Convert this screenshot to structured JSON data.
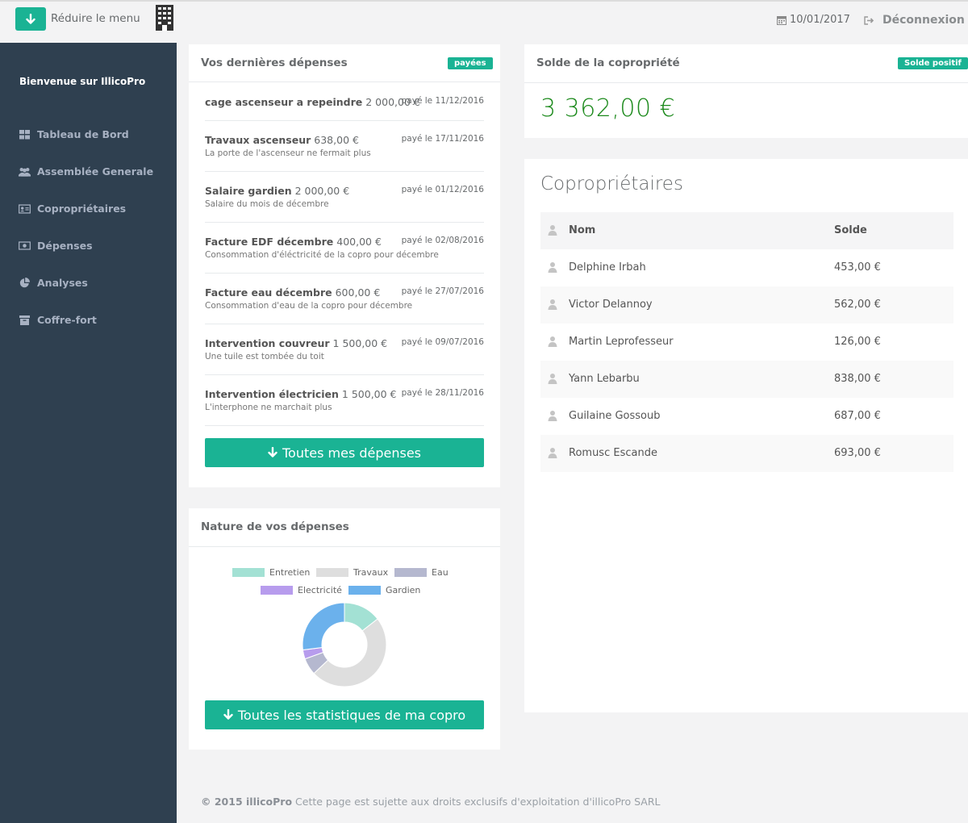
{
  "topbar": {
    "menu_label": "Réduire le menu",
    "date": "10/01/2017",
    "logout_label": "Déconnexion"
  },
  "sidebar": {
    "welcome": "Bienvenue sur IllicoPro",
    "items": [
      {
        "label": "Tableau de Bord",
        "icon": "dashboard-icon"
      },
      {
        "label": "Assemblée Generale",
        "icon": "users-icon"
      },
      {
        "label": "Copropriétaires",
        "icon": "id-card-icon"
      },
      {
        "label": "Dépenses",
        "icon": "money-icon"
      },
      {
        "label": "Analyses",
        "icon": "pie-chart-icon"
      },
      {
        "label": "Coffre-fort",
        "icon": "archive-icon"
      }
    ]
  },
  "expenses": {
    "title": "Vos dernières dépenses",
    "badge": "payées",
    "items": [
      {
        "name": "cage ascenseur a repeindre",
        "amount": "2 000,00 €",
        "paid": "payé le 11/12/2016",
        "desc": ""
      },
      {
        "name": "Travaux ascenseur",
        "amount": "638,00 €",
        "paid": "payé le 17/11/2016",
        "desc": "La porte de l'ascenseur ne fermait plus"
      },
      {
        "name": "Salaire gardien",
        "amount": "2 000,00 €",
        "paid": "payé le 01/12/2016",
        "desc": "Salaire du mois de décembre"
      },
      {
        "name": "Facture EDF décembre",
        "amount": "400,00 €",
        "paid": "payé le 02/08/2016",
        "desc": "Consommation d'éléctricité de la copro pour décembre"
      },
      {
        "name": "Facture eau décembre",
        "amount": "600,00 €",
        "paid": "payé le 27/07/2016",
        "desc": "Consommation d'eau de la copro pour décembre"
      },
      {
        "name": "Intervention couvreur",
        "amount": "1 500,00 €",
        "paid": "payé le 09/07/2016",
        "desc": "Une tuile est tombée du toit"
      },
      {
        "name": "Intervention électricien",
        "amount": "1 500,00 €",
        "paid": "payé le 28/11/2016",
        "desc": "L'interphone ne marchait plus"
      }
    ],
    "button": "Toutes mes dépenses"
  },
  "balance": {
    "title": "Solde de la copropriété",
    "badge": "Solde positif",
    "amount": "3 362,00 €",
    "amount_color": "#1c8a1c"
  },
  "owners": {
    "title": "Copropriétaires",
    "col_name": "Nom",
    "col_balance": "Solde",
    "rows": [
      {
        "name": "Delphine Irbah",
        "balance": "453,00 €"
      },
      {
        "name": "Victor Delannoy",
        "balance": "562,00 €"
      },
      {
        "name": "Martin Leprofesseur",
        "balance": "126,00 €"
      },
      {
        "name": "Yann Lebarbu",
        "balance": "838,00 €"
      },
      {
        "name": "Guilaine Gossoub",
        "balance": "687,00 €"
      },
      {
        "name": "Romusc Escande",
        "balance": "693,00 €"
      }
    ]
  },
  "nature": {
    "title": "Nature de vos dépenses",
    "button": "Toutes les statistiques de ma copro"
  },
  "chart_data": {
    "type": "pie",
    "donut": true,
    "categories": [
      "Entretien",
      "Travaux",
      "Eau",
      "Electricité",
      "Gardien"
    ],
    "values": [
      14.5,
      48.5,
      6.5,
      3.5,
      27
    ],
    "colors": [
      "#a3e1d4",
      "#dedede",
      "#b5b8cf",
      "#b79ced",
      "#6bb1ec"
    ],
    "legend_position": "top"
  },
  "footer": {
    "brand": "© 2015 illicoPro",
    "text": " Cette page est sujette aux droits exclusifs d'exploitation d'illicoPro SARL"
  }
}
